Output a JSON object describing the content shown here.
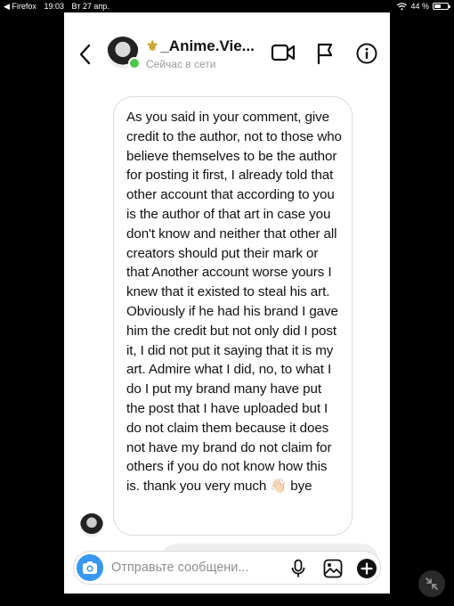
{
  "status_bar": {
    "back_app": "◀ Firefox",
    "time": "19:03",
    "date": "Вт 27 апр.",
    "battery": "44 %",
    "battery_level": 0.44
  },
  "header": {
    "title": "_Anime.Vie...",
    "status": "Сейчас в сети"
  },
  "message": {
    "text": "As you said in your comment, give credit to the author, not to those who believe themselves to be the author for posting it first, I already told that other account that according to you is the author of that art in case you don't know and neither that other all creators should put their mark or that Another account worse yours I knew that it existed to steal his art. Obviously if he had his brand I gave him the credit but not only did I post it, I did not put it saying that it is my art. Admire what I did, no, to what I do I put my brand many have put the post that I have uploaded but I do not claim them because it does not have my brand do not claim for others if you do not know how this is. thank you very much 👋🏻 bye"
  },
  "composer": {
    "placeholder": "Отправьте сообщени...",
    "value": ""
  },
  "icons": {
    "back": "chevron-left-icon",
    "video": "video-camera-icon",
    "flag": "flag-icon",
    "info": "info-icon",
    "camera": "camera-icon",
    "mic": "microphone-icon",
    "gallery": "image-icon",
    "plus": "plus-circle-icon",
    "collapse": "collapse-arrows-icon"
  },
  "colors": {
    "online": "#4bc74b",
    "camera_button": "#3897f0",
    "fleur": "#c9a227"
  }
}
